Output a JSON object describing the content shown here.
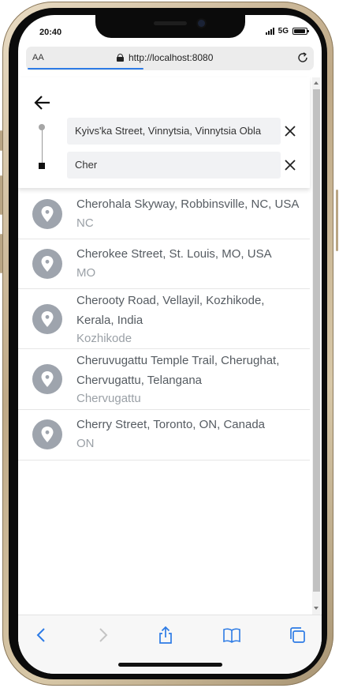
{
  "status_bar": {
    "time": "20:40",
    "network": "5G"
  },
  "browser": {
    "aa_label": "AA",
    "url": "http://localhost:8080",
    "load_progress": 0.42
  },
  "route": {
    "origin_value": "Kyivs'ka Street, Vinnytsia, Vinnytsia Obla",
    "destination_value": "Cher"
  },
  "results": [
    {
      "title": "Cherohala Skyway, Robbinsville, NC, USA",
      "subtitle": "NC"
    },
    {
      "title": "Cherokee Street, St. Louis, MO, USA",
      "subtitle": "MO"
    },
    {
      "title": "Cherooty Road, Vellayil, Kozhikode, Kerala, India",
      "subtitle": "Kozhikode"
    },
    {
      "title": "Cheruvugattu Temple Trail, Cherughat, Chervugattu, Telangana",
      "subtitle": "Chervugattu"
    },
    {
      "title": "Cherry Street, Toronto, ON, Canada",
      "subtitle": "ON"
    }
  ],
  "toolbar": {
    "icons": [
      "back-icon",
      "forward-icon",
      "share-icon",
      "bookmarks-icon",
      "tabs-icon"
    ]
  },
  "colors": {
    "accent": "#2d7be5",
    "pin": "#9ea4ad"
  }
}
